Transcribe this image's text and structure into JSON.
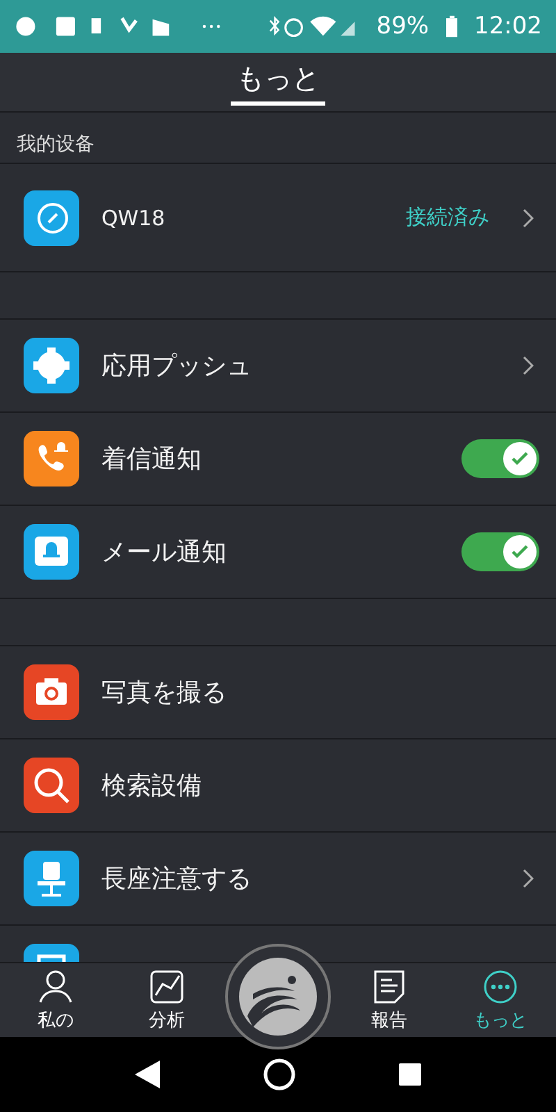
{
  "status_bar": {
    "battery": "89%",
    "time": "12:02"
  },
  "header": {
    "title": "もっと"
  },
  "section_label": "我的设备",
  "groups": [
    [
      {
        "kind": "chevron",
        "label": "QW18",
        "status": "接続済み"
      }
    ],
    [
      {
        "kind": "chevron",
        "label": "応用プッシュ"
      },
      {
        "kind": "toggle",
        "label": "着信通知",
        "on": true
      },
      {
        "kind": "toggle",
        "label": "メール通知",
        "on": true
      }
    ],
    [
      {
        "kind": "plain",
        "label": "写真を撮る"
      },
      {
        "kind": "plain",
        "label": "検索設備"
      },
      {
        "kind": "chevron",
        "label": "長座注意する"
      },
      {
        "kind": "partial"
      }
    ]
  ],
  "tabs": [
    {
      "label": "私の",
      "selected": false
    },
    {
      "label": "分析",
      "selected": false
    },
    {
      "kind": "center"
    },
    {
      "label": "報告",
      "selected": false
    },
    {
      "label": "もっと",
      "selected": true
    }
  ]
}
